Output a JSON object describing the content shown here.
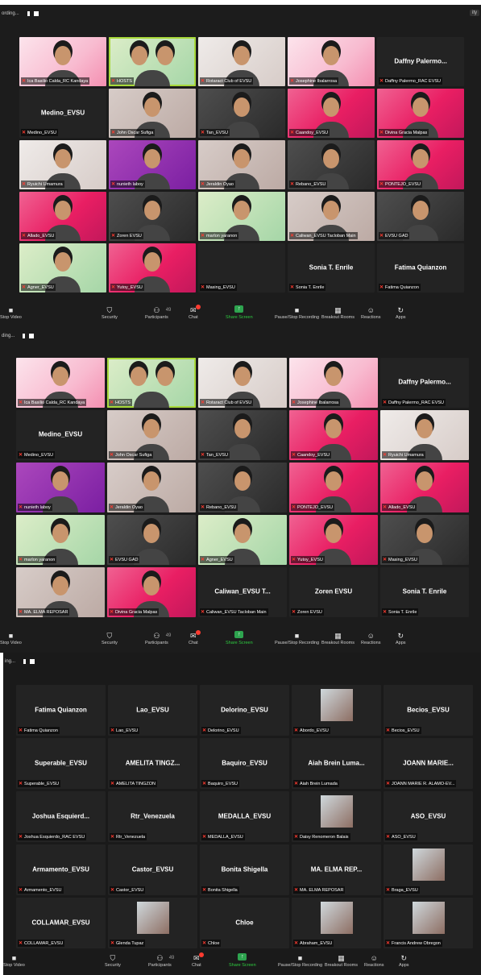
{
  "screenshot1": {
    "recording_label": "ording...",
    "top_right": "ity",
    "tiles": [
      {
        "name": "Ica Basilio Calda_RC Kandaya",
        "style": "pinklight",
        "people": 1
      },
      {
        "name": "HOSTS",
        "style": "green",
        "people": 2,
        "active": true
      },
      {
        "name": "Rotaract Club of EVSU",
        "style": "cream",
        "people": 1
      },
      {
        "name": "Josephine Ibalarrosa",
        "style": "pinklight",
        "people": 1
      },
      {
        "name": "Daffny Palermo_RAC EVSU",
        "display": "Daffny Palermo...",
        "style": "name"
      },
      {
        "name": "Medino_EVSU",
        "display": "Medino_EVSU",
        "style": "name"
      },
      {
        "name": "John Oscar Sufiga",
        "style": "warm",
        "people": 1
      },
      {
        "name": "Tan_EVSU",
        "style": "dark",
        "people": 1
      },
      {
        "name": "Caandoy_EVSU",
        "style": "pink",
        "people": 1
      },
      {
        "name": "Divina Gracia Malpas",
        "style": "pink",
        "people": 1
      },
      {
        "name": "Ryuichi Umamura",
        "style": "cream",
        "people": 1
      },
      {
        "name": "nunieth laboy",
        "style": "purple",
        "people": 1
      },
      {
        "name": "Jeraldin Oyao",
        "style": "warm",
        "people": 1
      },
      {
        "name": "Rebano_EVSU",
        "style": "dark",
        "people": 1
      },
      {
        "name": "PONTEJO_EVSU",
        "style": "pink",
        "people": 1
      },
      {
        "name": "Allado_EVSU",
        "style": "pink",
        "people": 1
      },
      {
        "name": "Zoren EVSU",
        "style": "dark",
        "people": 1
      },
      {
        "name": "marlon yaranon",
        "style": "green",
        "people": 1
      },
      {
        "name": "Caliwan_EVSU Tacloban Main",
        "style": "warm",
        "people": 1
      },
      {
        "name": "EVSU GAD",
        "style": "dark",
        "people": 1
      },
      {
        "name": "Agner_EVSU",
        "style": "green",
        "people": 1
      },
      {
        "name": "Yutoy_EVSU",
        "style": "pink",
        "people": 1
      },
      {
        "name": "Masing_EVSU",
        "style": "empty"
      },
      {
        "name": "Sonia T. Enrile",
        "display": "Sonia T. Enrile",
        "style": "name"
      },
      {
        "name": "Fatima Quianzon",
        "display": "Fatima Quianzon",
        "style": "name"
      }
    ]
  },
  "screenshot2": {
    "recording_label": "ding...",
    "tiles": [
      {
        "name": "Ica Basilio Calda_RC Kandaya",
        "style": "pinklight",
        "people": 1
      },
      {
        "name": "HOSTS",
        "style": "green",
        "people": 2,
        "active": true
      },
      {
        "name": "Rotaract Club of EVSU",
        "style": "cream",
        "people": 1
      },
      {
        "name": "Josephine Ibalarrosa",
        "style": "pinklight",
        "people": 1
      },
      {
        "name": "Daffny Palermo_RAC EVSU",
        "display": "Daffny Palermo...",
        "style": "name"
      },
      {
        "name": "Medino_EVSU",
        "display": "Medino_EVSU",
        "style": "name"
      },
      {
        "name": "John Oscar Sufiga",
        "style": "warm",
        "people": 1
      },
      {
        "name": "Tan_EVSU",
        "style": "dark",
        "people": 1
      },
      {
        "name": "Caandoy_EVSU",
        "style": "pink",
        "people": 1
      },
      {
        "name": "Ryuichi Umamura",
        "style": "cream",
        "people": 1
      },
      {
        "name": "nunieth laboy",
        "style": "purple",
        "people": 1
      },
      {
        "name": "Jeraldin Oyao",
        "style": "warm",
        "people": 1
      },
      {
        "name": "Rebano_EVSU",
        "style": "dark",
        "people": 1
      },
      {
        "name": "PONTEJO_EVSU",
        "style": "pink",
        "people": 1
      },
      {
        "name": "Allado_EVSU",
        "style": "pink",
        "people": 1
      },
      {
        "name": "marlon yaranon",
        "style": "green",
        "people": 1
      },
      {
        "name": "EVSU GAD",
        "style": "dark",
        "people": 1
      },
      {
        "name": "Agner_EVSU",
        "style": "green",
        "people": 1
      },
      {
        "name": "Yutoy_EVSU",
        "style": "pink",
        "people": 1
      },
      {
        "name": "Masing_EVSU",
        "style": "dark",
        "people": 1
      },
      {
        "name": "MA. ELMA REPOSAR",
        "style": "warm",
        "people": 1
      },
      {
        "name": "Divina Gracia Malpas",
        "style": "pink",
        "people": 1
      },
      {
        "name": "Caliwan_EVSU Tacloban Main",
        "display": "Caliwan_EVSU T...",
        "style": "name"
      },
      {
        "name": "Zoren EVSU",
        "display": "Zoren EVSU",
        "style": "name"
      },
      {
        "name": "Sonia T. Enrile",
        "display": "Sonia T. Enrile",
        "style": "name"
      }
    ]
  },
  "screenshot3": {
    "recording_label": "ing...",
    "tiles": [
      {
        "name": "Fatima Quianzon",
        "display": "Fatima Quianzon",
        "style": "name"
      },
      {
        "name": "Lao_EVSU",
        "display": "Lao_EVSU",
        "style": "name"
      },
      {
        "name": "Delorino_EVSU",
        "display": "Delorino_EVSU",
        "style": "name"
      },
      {
        "name": "Abordo_EVSU",
        "style": "avatar"
      },
      {
        "name": "Becios_EVSU",
        "display": "Becios_EVSU",
        "style": "name"
      },
      {
        "name": "Superable_EVSU",
        "display": "Superable_EVSU",
        "style": "name"
      },
      {
        "name": "AMELITA TINGZON",
        "display": "AMELITA TINGZ...",
        "style": "name"
      },
      {
        "name": "Baquiro_EVSU",
        "display": "Baquiro_EVSU",
        "style": "name"
      },
      {
        "name": "Aiah Brein Lumada",
        "display": "Aiah Brein Luma...",
        "style": "name"
      },
      {
        "name": "JOANN MARIE R. ALAMO-EV...",
        "display": "JOANN MARIE...",
        "style": "name"
      },
      {
        "name": "Joshua Esquierdo_RAC EVSU",
        "display": "Joshua Esquierd...",
        "style": "name"
      },
      {
        "name": "Rtr_Venezuela",
        "display": "Rtr_Venezuela",
        "style": "name"
      },
      {
        "name": "MEDALLA_EVSU",
        "display": "MEDALLA_EVSU",
        "style": "name"
      },
      {
        "name": "Daisy Renomeron Balais",
        "style": "avatar"
      },
      {
        "name": "ASO_EVSU",
        "display": "ASO_EVSU",
        "style": "name"
      },
      {
        "name": "Armamento_EVSU",
        "display": "Armamento_EVSU",
        "style": "name"
      },
      {
        "name": "Castor_EVSU",
        "display": "Castor_EVSU",
        "style": "name"
      },
      {
        "name": "Bonita Shigella",
        "display": "Bonita Shigella",
        "style": "name"
      },
      {
        "name": "MA. ELMA REPOSAR",
        "display": "MA. ELMA REP...",
        "style": "name"
      },
      {
        "name": "Braga_EVSU",
        "style": "avatar"
      },
      {
        "name": "COLLAMAR_EVSU",
        "display": "COLLAMAR_EVSU",
        "style": "name"
      },
      {
        "name": "Glenda Tupaz",
        "style": "avatar"
      },
      {
        "name": "Chloe",
        "display": "Chloe",
        "style": "name"
      },
      {
        "name": "Abraham_EVSU",
        "style": "avatar"
      },
      {
        "name": "Francis Andrew Obregon",
        "style": "avatar"
      }
    ]
  },
  "toolbar": {
    "stop_video": "Stop Video",
    "security": "Security",
    "participants": "Participants",
    "participants_count": "49",
    "chat": "Chat",
    "share_screen": "Share Screen",
    "pause_recording": "Pause/Stop Recording",
    "breakout_rooms": "Breakout Rooms",
    "reactions": "Reactions",
    "apps": "Apps"
  }
}
